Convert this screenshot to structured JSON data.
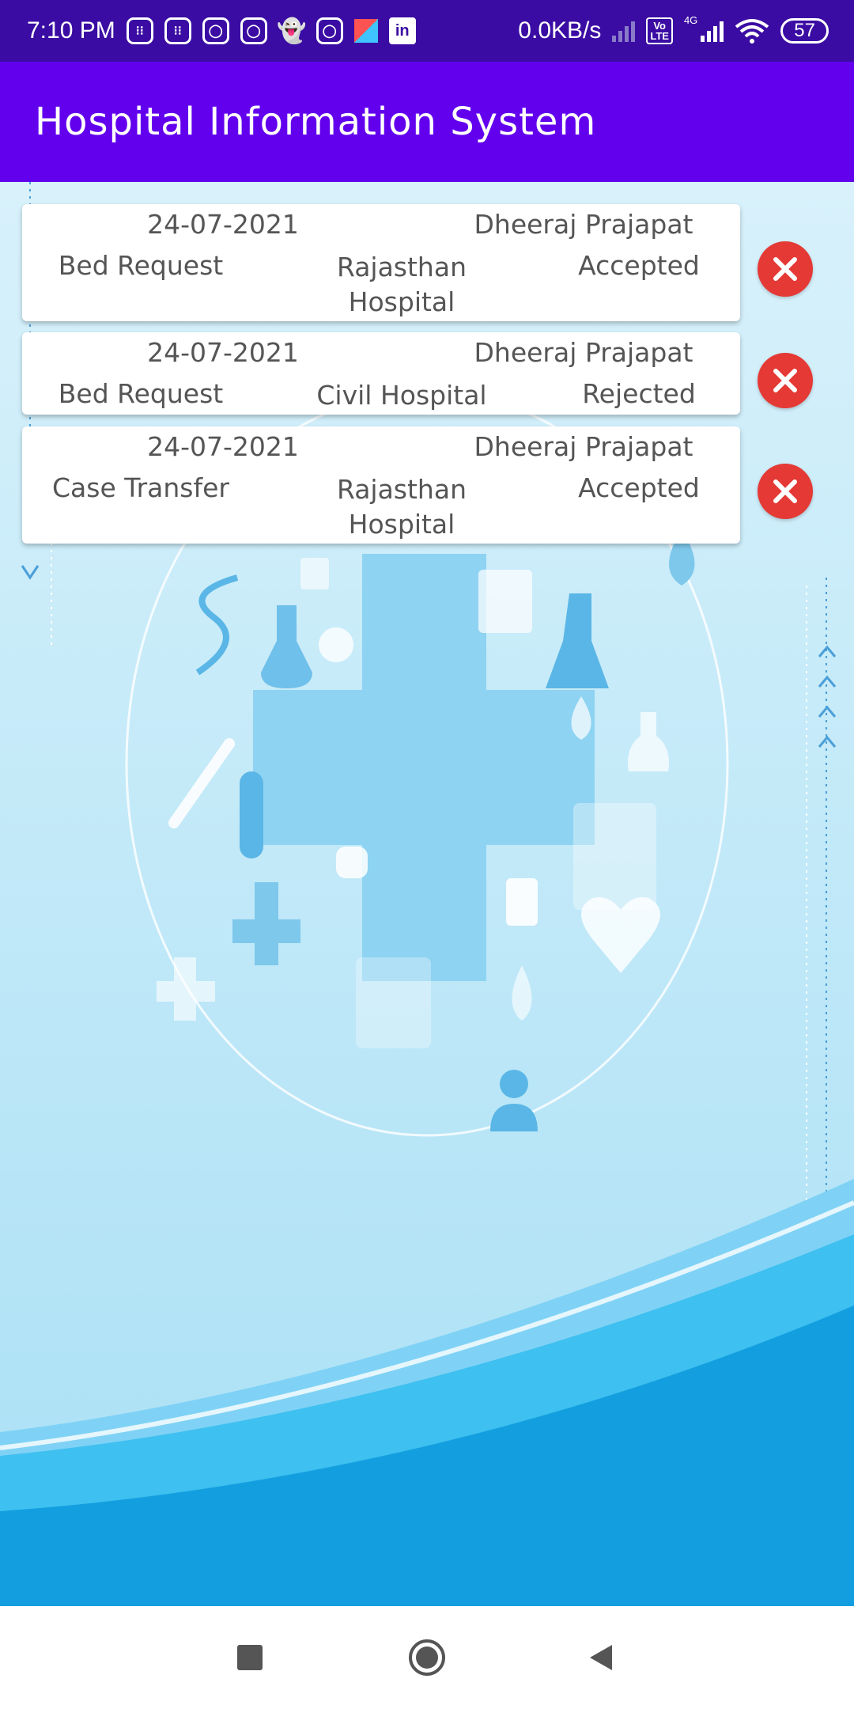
{
  "status_bar": {
    "time": "7:10 PM",
    "network_speed": "0.0KB/s",
    "volte_label": "Vo\nLTE",
    "network_type": "4G",
    "battery": "57",
    "notification_icons": [
      "calculator-icon",
      "calculator-icon",
      "instagram-icon",
      "instagram-icon",
      "snapchat-icon",
      "instagram-icon",
      "kite-icon",
      "linkedin-icon"
    ]
  },
  "app_bar": {
    "title": "Hospital Information System"
  },
  "requests": [
    {
      "date": "24-07-2021",
      "name": "Dheeraj Prajapat",
      "type": "Bed Request",
      "hospital": "Rajasthan Hospital",
      "status": "Accepted"
    },
    {
      "date": "24-07-2021",
      "name": "Dheeraj Prajapat",
      "type": "Bed Request",
      "hospital": "Civil Hospital",
      "status": "Rejected"
    },
    {
      "date": "24-07-2021",
      "name": "Dheeraj Prajapat",
      "type": "Case Transfer",
      "hospital": "Rajasthan Hospital",
      "status": "Accepted"
    }
  ],
  "colors": {
    "status_bar": "#3a0ca3",
    "app_bar": "#6200ee",
    "delete": "#e53935",
    "background": "#c9ecf8"
  },
  "nav_icons": [
    "recents-icon",
    "home-icon",
    "back-icon"
  ]
}
